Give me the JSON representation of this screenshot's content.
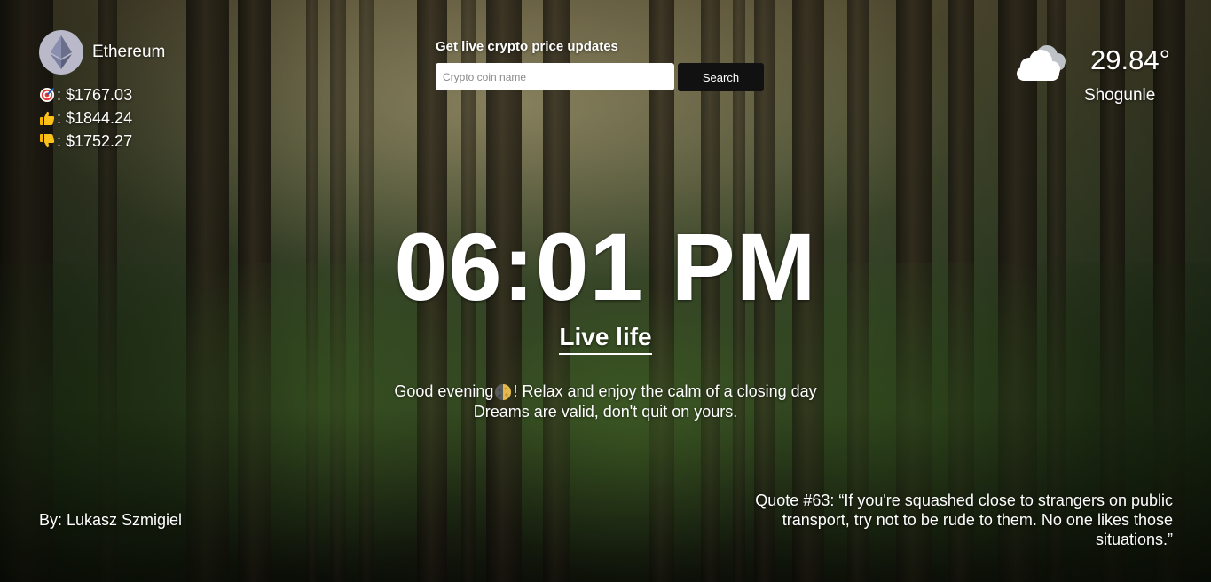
{
  "crypto": {
    "coin_name": "Ethereum",
    "coin_icon": "ethereum-logo-icon",
    "current": {
      "icon": "target-icon",
      "value": ": $1767.03"
    },
    "high": {
      "icon": "thumbs-up-icon",
      "value": ": $1844.24"
    },
    "low": {
      "icon": "thumbs-down-icon",
      "value": ": $1752.27"
    }
  },
  "search": {
    "title": "Get live crypto price updates",
    "placeholder": "Crypto coin name",
    "button_label": "Search"
  },
  "weather": {
    "icon": "cloudy-icon",
    "temperature": "29.84°",
    "city": "Shogunle"
  },
  "clock": {
    "time": "06:01 PM"
  },
  "mantra": "Live life",
  "greeting": {
    "prefix": "Good evening",
    "emoji": "moon-icon",
    "suffix": "! Relax and enjoy the calm of a closing day",
    "line2": "Dreams are valid, don't quit on yours."
  },
  "author": "By: Lukasz Szmigiel",
  "quote": "Quote #63: “If you're squashed close to strangers on public transport, try not to be rude to them. No one likes those situations.”",
  "colors": {
    "text": "#ffffff",
    "button_bg": "#111111",
    "input_bg": "#ffffff"
  }
}
